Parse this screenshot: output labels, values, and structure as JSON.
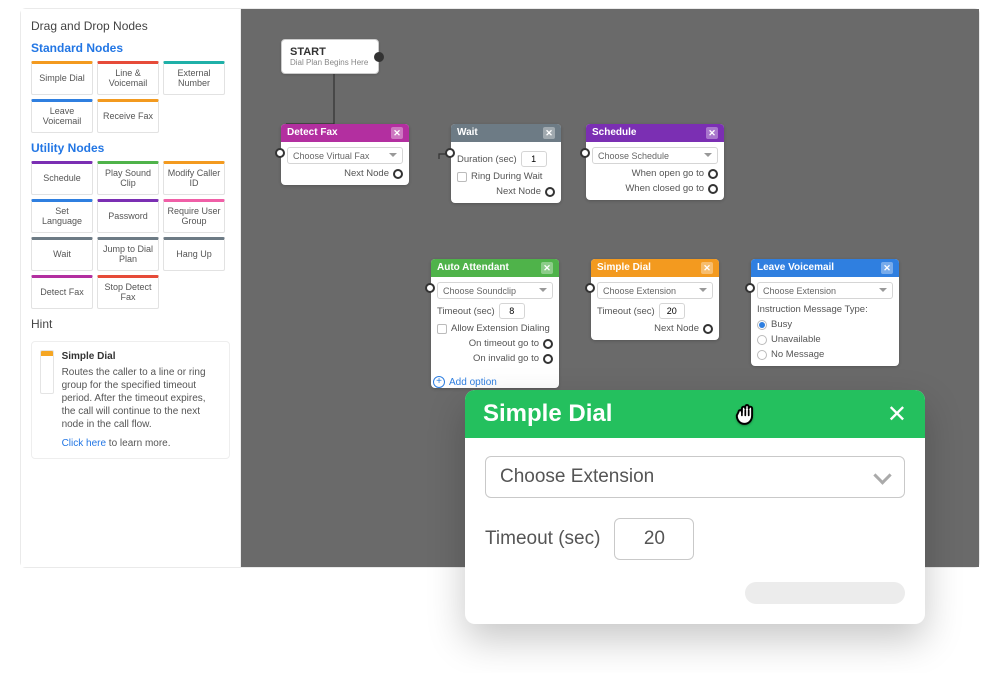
{
  "sidebar": {
    "title": "Drag and Drop Nodes",
    "standard_heading": "Standard Nodes",
    "utility_heading": "Utility Nodes",
    "standard": [
      {
        "label": "Simple Dial",
        "cls": "c-orange"
      },
      {
        "label": "Line & Voicemail",
        "cls": "c-red"
      },
      {
        "label": "External Number",
        "cls": "c-teal"
      },
      {
        "label": "Leave Voicemail",
        "cls": "c-blue"
      },
      {
        "label": "Receive Fax",
        "cls": "c-orange"
      }
    ],
    "utility": [
      {
        "label": "Schedule",
        "cls": "c-purple"
      },
      {
        "label": "Play Sound Clip",
        "cls": "c-green"
      },
      {
        "label": "Modify Caller ID",
        "cls": "c-orange"
      },
      {
        "label": "Set Language",
        "cls": "c-blue"
      },
      {
        "label": "Password",
        "cls": "c-purple"
      },
      {
        "label": "Require User Group",
        "cls": "c-pink"
      },
      {
        "label": "Wait",
        "cls": "c-gray"
      },
      {
        "label": "Jump to Dial Plan",
        "cls": "c-gray"
      },
      {
        "label": "Hang Up",
        "cls": "c-gray"
      },
      {
        "label": "Detect Fax",
        "cls": "c-magenta"
      },
      {
        "label": "Stop Detect Fax",
        "cls": "c-red"
      }
    ],
    "hint": {
      "heading": "Hint",
      "title": "Simple Dial",
      "body": "Routes the caller to a line or ring group for the specified timeout period. After the timeout expires, the call will continue to the next node in the call flow.",
      "link_text": "Click here",
      "link_suffix": " to learn more."
    }
  },
  "canvas": {
    "start": {
      "title": "START",
      "subtitle": "Dial Plan Begins Here"
    },
    "detect_fax": {
      "title": "Detect Fax",
      "select": "Choose Virtual Fax",
      "port": "Next Node"
    },
    "wait": {
      "title": "Wait",
      "duration_label": "Duration (sec)",
      "duration_value": "1",
      "ring_label": "Ring During Wait",
      "port": "Next Node"
    },
    "schedule": {
      "title": "Schedule",
      "select": "Choose Schedule",
      "open": "When open go to",
      "closed": "When closed go to"
    },
    "auto_attendant": {
      "title": "Auto Attendant",
      "select": "Choose Soundclip",
      "timeout_label": "Timeout (sec)",
      "timeout_value": "8",
      "allow_label": "Allow Extension Dialing",
      "on_timeout": "On timeout go to",
      "on_invalid": "On invalid go to",
      "add_option": "Add option"
    },
    "simple_dial": {
      "title": "Simple Dial",
      "select": "Choose Extension",
      "timeout_label": "Timeout (sec)",
      "timeout_value": "20",
      "port": "Next Node"
    },
    "leave_vm": {
      "title": "Leave Voicemail",
      "select": "Choose Extension",
      "instr": "Instruction Message Type:",
      "opts": [
        "Busy",
        "Unavailable",
        "No Message"
      ]
    }
  },
  "popup": {
    "title": "Simple Dial",
    "select": "Choose Extension",
    "timeout_label": "Timeout (sec)",
    "timeout_value": "20"
  }
}
